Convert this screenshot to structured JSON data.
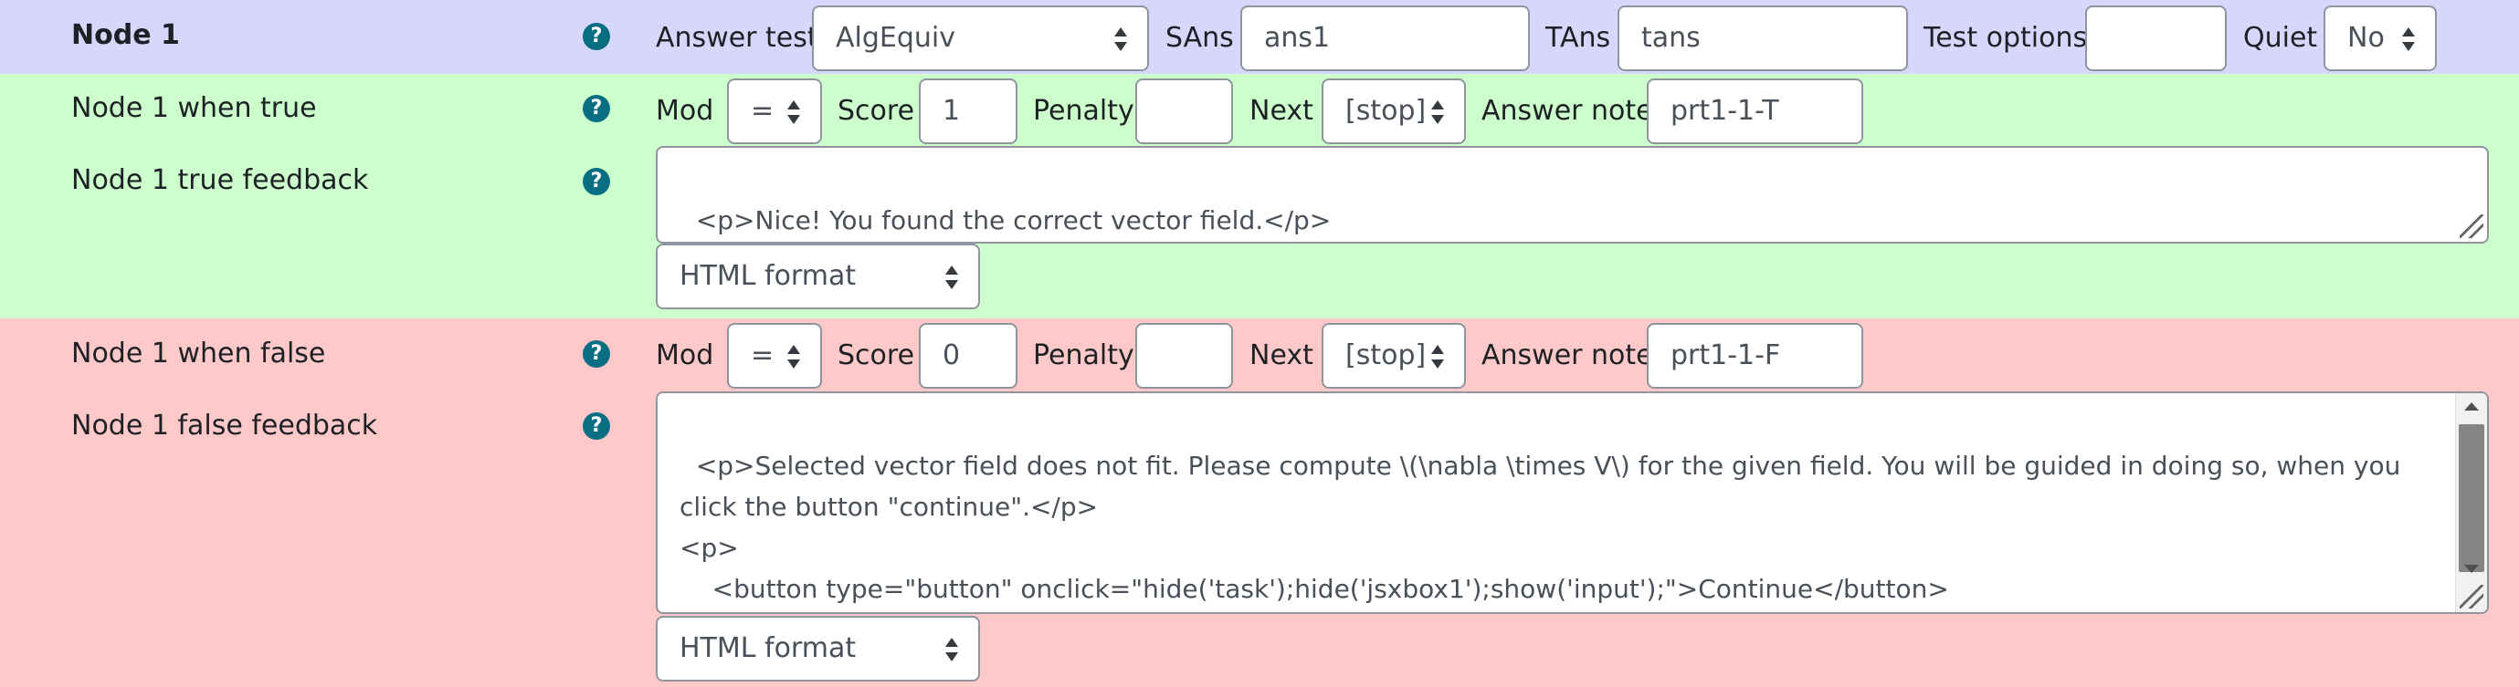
{
  "node": {
    "title": "Node 1",
    "answer_test_label": "Answer test",
    "answer_test_value": "AlgEquiv",
    "sans_label": "SAns",
    "sans_value": "ans1",
    "tans_label": "TAns",
    "tans_value": "tans",
    "test_options_label": "Test options",
    "test_options_value": "",
    "quiet_label": "Quiet",
    "quiet_value": "No"
  },
  "true_branch": {
    "row_label": "Node 1 when true",
    "mod_label": "Mod",
    "mod_value": "=",
    "score_label": "Score",
    "score_value": "1",
    "penalty_label": "Penalty",
    "penalty_value": "",
    "next_label": "Next",
    "next_value": "[stop]",
    "answer_note_label": "Answer note",
    "answer_note_value": "prt1-1-T",
    "feedback_label": "Node 1 true feedback",
    "feedback_text": "<p>Nice! You found the correct vector field.</p>",
    "format_value": "HTML format"
  },
  "false_branch": {
    "row_label": "Node 1 when false",
    "mod_label": "Mod",
    "mod_value": "=",
    "score_label": "Score",
    "score_value": "0",
    "penalty_label": "Penalty",
    "penalty_value": "",
    "next_label": "Next",
    "next_value": "[stop]",
    "answer_note_label": "Answer note",
    "answer_note_value": "prt1-1-F",
    "feedback_label": "Node 1 false feedback",
    "feedback_text": "<p>Selected vector field does not fit. Please compute \\(\\nabla \\times V\\) for the given field. You will be guided in doing so, when you click the button \"continue\".</p>\n<p>\n    <button type=\"button\" onclick=\"hide('task');hide('jsxbox1');show('input');\">Continue</button>\n</p>",
    "format_value": "HTML format"
  },
  "icons": {
    "help": "question-circle-icon",
    "select_caret": "sort-caret-icon",
    "resize": "resize-handle-icon"
  },
  "colors": {
    "node_band": "#d7d7fd",
    "true_band": "#ccffcc",
    "false_band": "#ffc9c9",
    "help_icon": "#0a6e82"
  }
}
